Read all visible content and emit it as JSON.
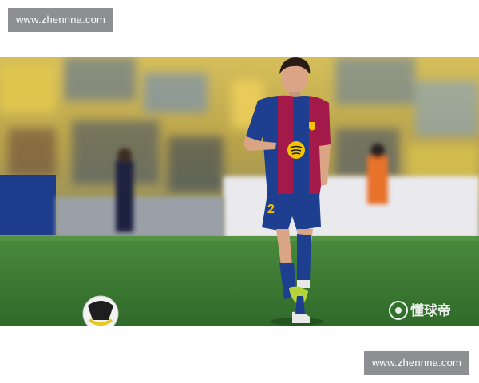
{
  "watermark_top": "www.zhennna.com",
  "watermark_bottom": "www.zhennna.com",
  "photo": {
    "subject": "soccer-player-kicking-ball",
    "jersey_number": "2",
    "site_logo_text": "懂球帝",
    "colors": {
      "pitch": "#3e7a34",
      "stands": "#c9b24a",
      "jersey_blue": "#1e3f8f",
      "jersey_red": "#a3194a",
      "sponsor": "#f2c400"
    }
  }
}
